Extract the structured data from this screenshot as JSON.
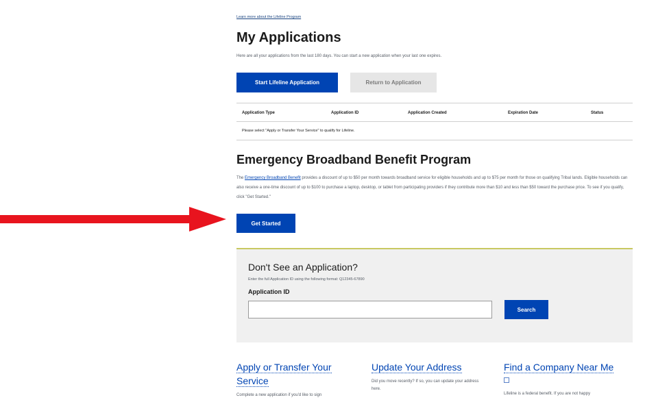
{
  "top_link": "Learn more about the Lifeline Program",
  "my_applications": {
    "title": "My Applications",
    "subtitle": "Here are all your applications from the last 180 days. You can start a new application when your last one expires.",
    "start_button": "Start Lifeline Application",
    "return_button": "Return to Application",
    "columns": [
      "Application Type",
      "Application ID",
      "Application Created",
      "Expiration Date",
      "Status"
    ],
    "empty_message": "Please select \"Apply or Transfer Your Service\" to qualify for Lifeline."
  },
  "ebb": {
    "title": "Emergency Broadband Benefit Program",
    "text_prefix": "The ",
    "link_text": "Emergency Broadband Benefit",
    "text_suffix": " provides a discount of up to $50 per month towards broadband service for eligible households and up to $75 per month for those on qualifying Tribal lands. Eligible households can also receive a one-time discount of up to $100 to purchase a laptop, desktop, or tablet from participating providers if they contribute more than $10 and less than $50 toward the purchase price. To see if you qualify, click \"Get Started.\"",
    "button": "Get Started"
  },
  "search_panel": {
    "title": "Don't See an Application?",
    "hint": "Enter the full Application ID using the following format: Q12345-67890",
    "label": "Application ID",
    "input_value": "",
    "button": "Search"
  },
  "columns_section": {
    "apply": {
      "title": "Apply or Transfer Your Service",
      "text": "Complete a new application if you'd like to sign"
    },
    "address": {
      "title": "Update Your Address",
      "text": "Did you move recently? If so, you can update your address here."
    },
    "company": {
      "title": "Find a Company Near Me",
      "text": "Lifeline is a federal benefit. If you are not happy"
    }
  },
  "colors": {
    "primary": "#0044b3",
    "arrow": "#e8141e",
    "divider": "#c8c861"
  }
}
